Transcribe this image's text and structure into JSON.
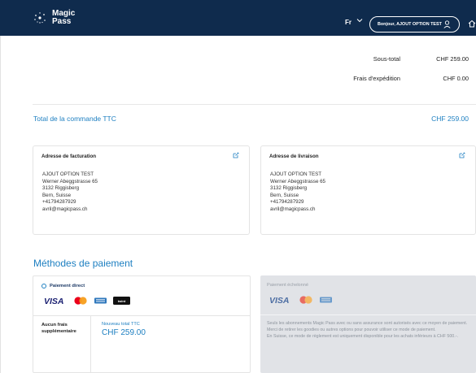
{
  "header": {
    "brand_line1": "Magic",
    "brand_line2": "Pass",
    "language": "Fr",
    "user_button": "Bonjour, AJOUT OPTION TEST"
  },
  "summary": {
    "rows": [
      {
        "label": "Sous-total",
        "value": "CHF 259.00"
      },
      {
        "label": "Frais d'expédition",
        "value": "CHF 0.00"
      }
    ],
    "total_label": "Total de la commande TTC",
    "total_value": "CHF 259.00"
  },
  "billing": {
    "title": "Adresse de facturation",
    "lines": [
      "AJOUT OPTION TEST",
      "Werner Abeggstrasse 65",
      "3132 Riggisberg",
      "Bern, Suisse",
      "+41794287929",
      "avril@magicpass.ch"
    ]
  },
  "shipping": {
    "title": "Adresse de livraison",
    "lines": [
      "AJOUT OPTION TEST",
      "Werner Abeggstrasse 65",
      "3132 Riggisberg",
      "Bern, Suisse",
      "+41794287929",
      "avril@magicpass.ch"
    ]
  },
  "payment": {
    "section_title": "Méthodes de paiement",
    "direct": {
      "title": "Paiement direct",
      "logos": [
        "VISA",
        "mastercard",
        "amex",
        "twint"
      ],
      "fees_text": "Aucun frais supplémentaire",
      "new_total_label": "Nouveau total TTC",
      "new_total_value": "CHF 259.00"
    },
    "installment": {
      "title": "Paiement échelonné",
      "logos": [
        "VISA",
        "mastercard",
        "amex"
      ],
      "message": [
        "Seuls les abonnements Magic Pass avec ou sans assurance sont autorisés avec ce moyen de paiement.",
        "Merci de retirer les goodies ou autres options pour pouvoir utiliser ce mode de paiement.",
        "En Suisse, ce mode de règlement est uniquement disponible pour les achats inférieurs à CHF 500.-."
      ]
    }
  },
  "colors": {
    "header_bg": "#0f2b4d",
    "accent_blue": "#1d7fc1",
    "disabled_bg": "#e1e3e7"
  }
}
